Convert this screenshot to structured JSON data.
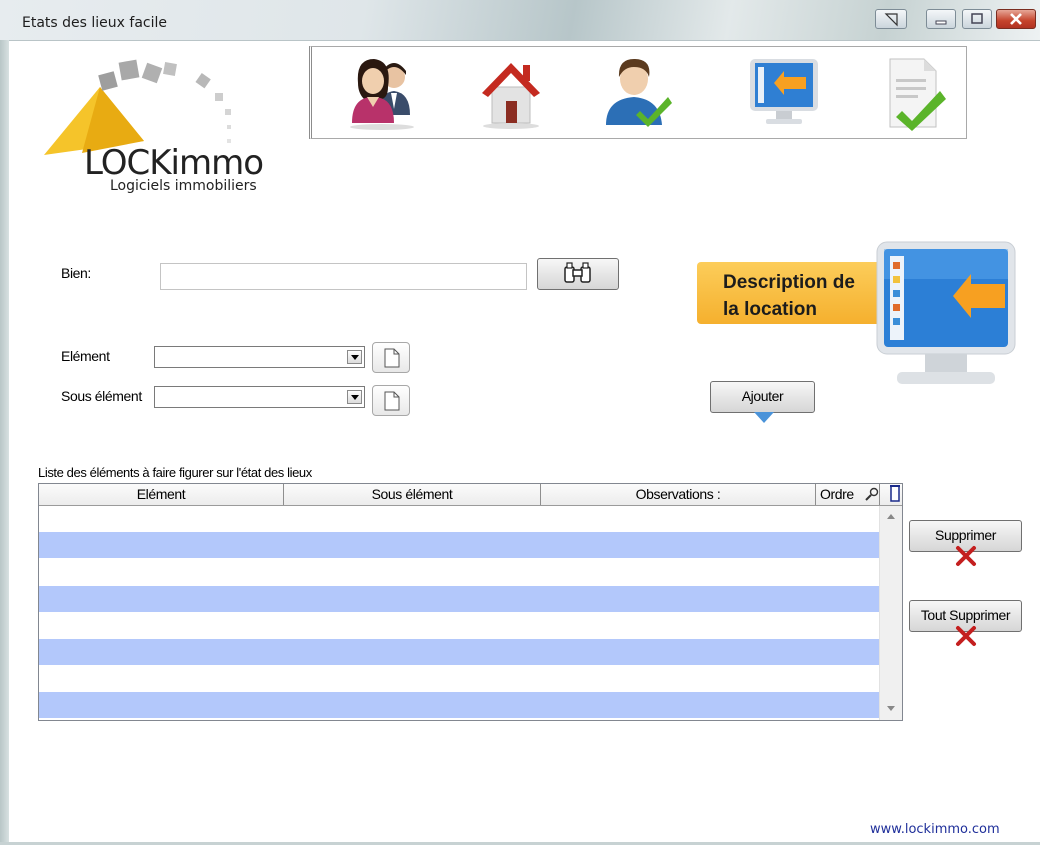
{
  "window": {
    "title": "Etats des lieux facile"
  },
  "toolbar": {
    "items": [
      {
        "name": "tenants-icon"
      },
      {
        "name": "property-house-icon"
      },
      {
        "name": "owner-check-icon"
      },
      {
        "name": "rental-description-icon"
      },
      {
        "name": "document-check-icon"
      }
    ]
  },
  "logo": {
    "brand": "LOCKimmo",
    "tagline": "Logiciels immobiliers"
  },
  "form": {
    "bien_label": "Bien:",
    "bien_value": "",
    "element_label": "Elément",
    "element_value": "",
    "sous_element_label": "Sous élément",
    "sous_element_value": ""
  },
  "panel": {
    "description_line1": "Description de",
    "description_line2": "la location"
  },
  "actions": {
    "ajouter": "Ajouter",
    "supprimer": "Supprimer",
    "tout_supprimer": "Tout Supprimer"
  },
  "grid": {
    "caption": "Liste des éléments à faire figurer sur l'état des lieux",
    "columns": [
      "Elément",
      "Sous élément",
      "Observations :",
      "Ordre"
    ],
    "rows": []
  },
  "footer": {
    "website": "www.lockimmo.com"
  },
  "colors": {
    "accent_orange": "#f7b733",
    "row_alt": "#b3c8fb",
    "link": "#1f2f9a"
  }
}
